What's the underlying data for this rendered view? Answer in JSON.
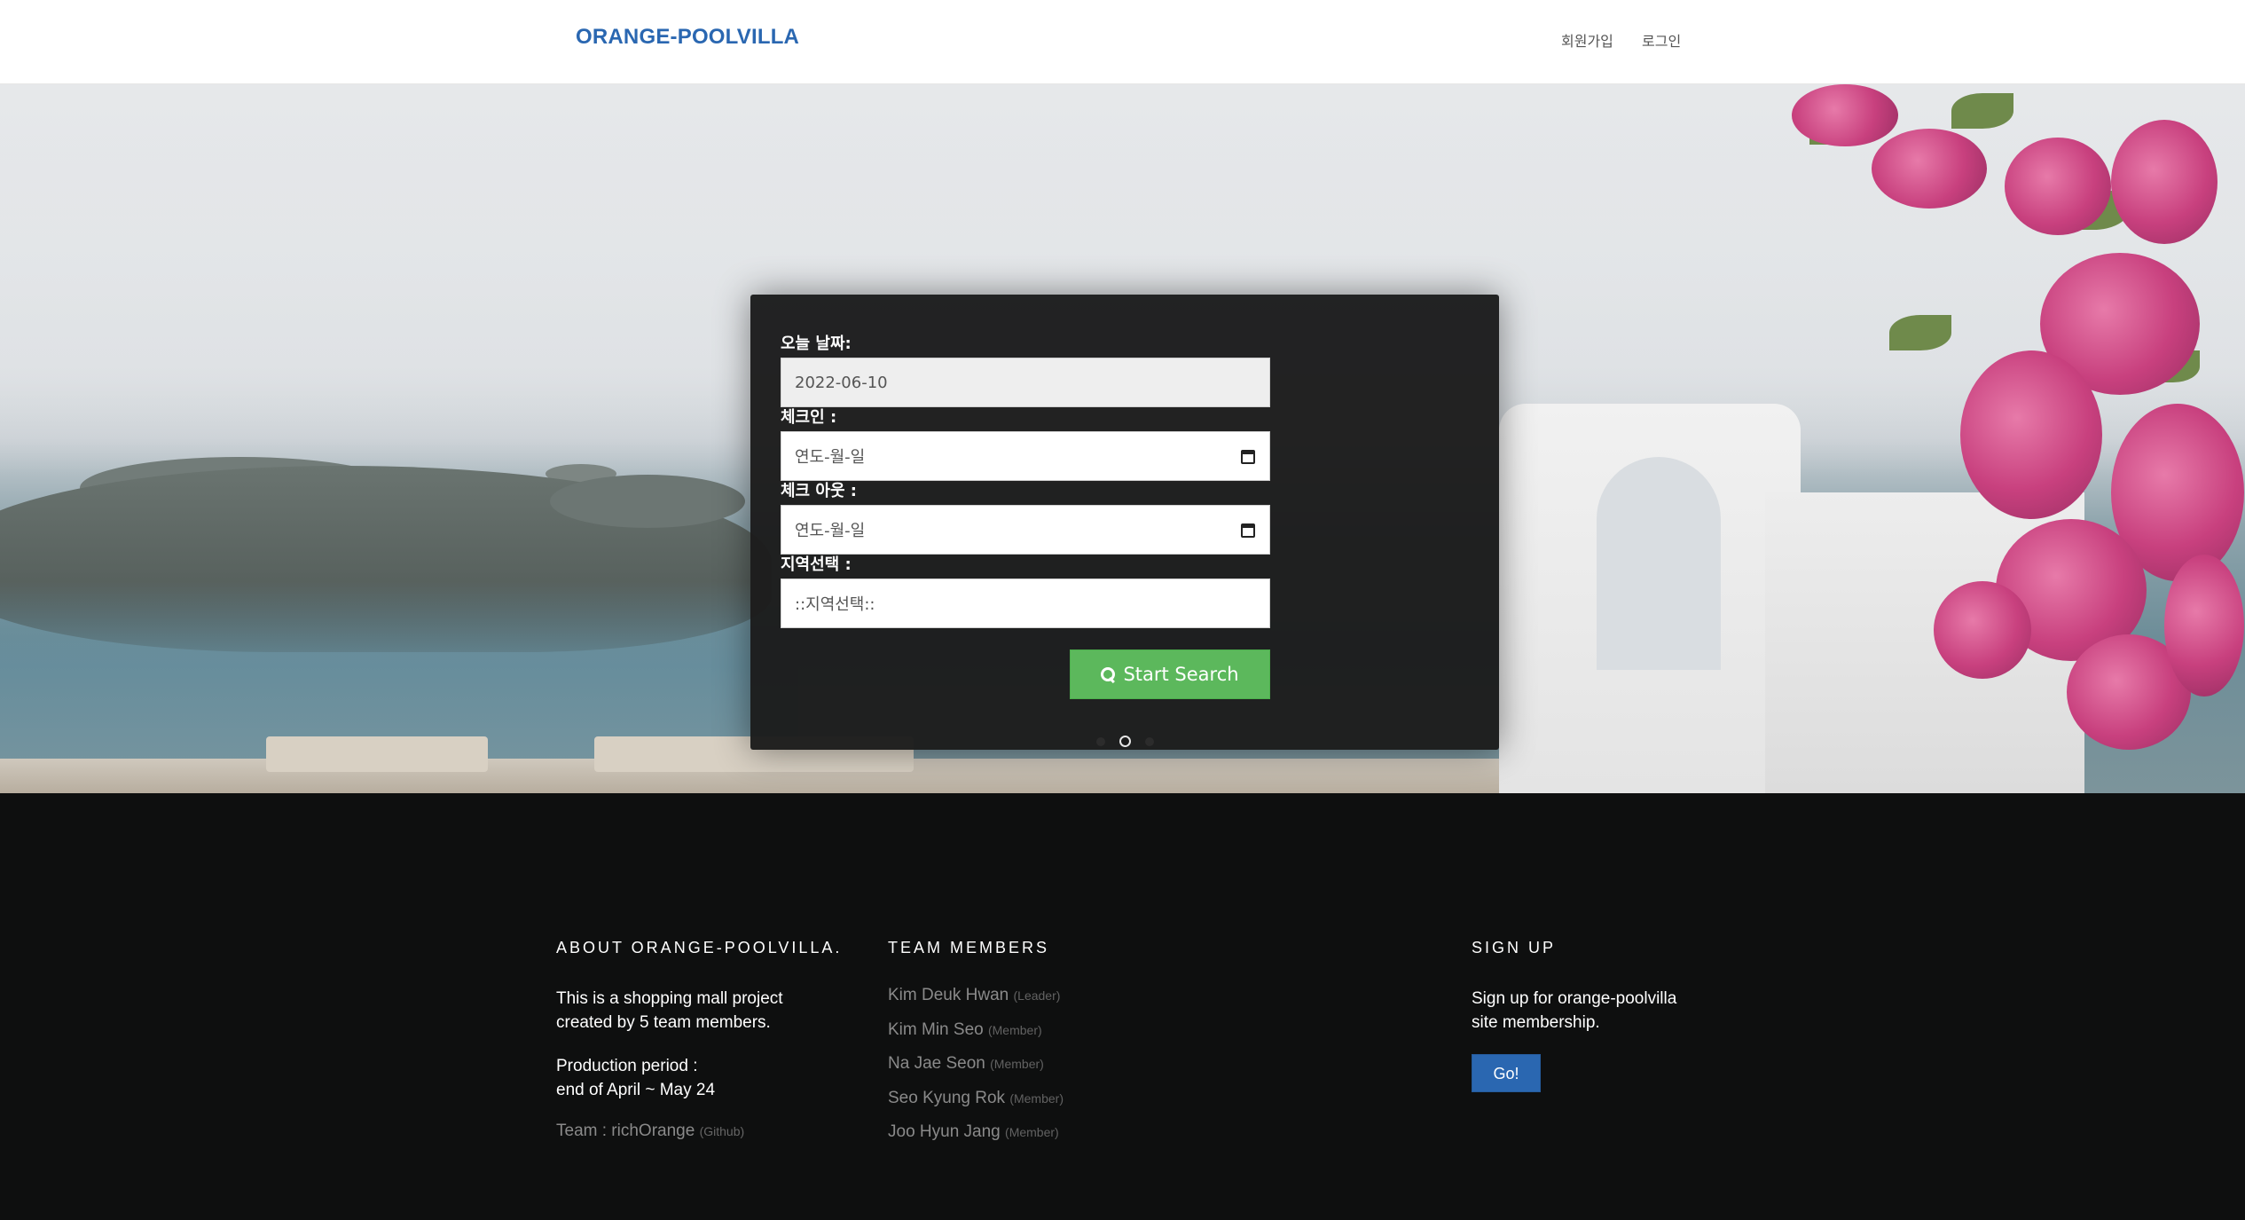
{
  "header": {
    "brand": "ORANGE-POOLVILLA",
    "nav": {
      "signup": "회원가입",
      "login": "로그인"
    }
  },
  "search": {
    "today_label": "오늘 날짜:",
    "today_value": "2022-06-10",
    "checkin_label": "체크인 :",
    "checkin_placeholder": "연도-월-일",
    "checkout_label": "체크 아웃 :",
    "checkout_placeholder": "연도-월-일",
    "region_label": "지역선택 :",
    "region_value": "::지역선택::",
    "button_label": "Start Search",
    "button_icon": "search-icon",
    "button_color": "#5cb85c"
  },
  "carousel": {
    "slide_count": 3,
    "active_index": 1
  },
  "footer": {
    "about": {
      "heading": "ABOUT ORANGE-POOLVILLA.",
      "desc_line1": "This is a shopping mall project",
      "desc_line2": "created by 5 team members.",
      "period_line1": "Production period :",
      "period_line2": "end of April ~ May 24",
      "team_text": "Team : richOrange",
      "team_note": "(Github)"
    },
    "team": {
      "heading": "TEAM MEMBERS",
      "members": [
        {
          "name": "Kim Deuk Hwan",
          "role": "(Leader)"
        },
        {
          "name": "Kim Min Seo",
          "role": "(Member)"
        },
        {
          "name": "Na Jae Seon",
          "role": "(Member)"
        },
        {
          "name": "Seo Kyung Rok",
          "role": "(Member)"
        },
        {
          "name": "Joo Hyun Jang",
          "role": "(Member)"
        }
      ]
    },
    "signup": {
      "heading": "SIGN UP",
      "line1": "Sign up for orange-poolvilla",
      "line2": "site membership.",
      "button": "Go!",
      "button_color": "#2a67b1"
    }
  },
  "colors": {
    "brand": "#2a67b1",
    "footer_bg": "#0e0f0f",
    "panel_bg": "#1c1c1c"
  }
}
